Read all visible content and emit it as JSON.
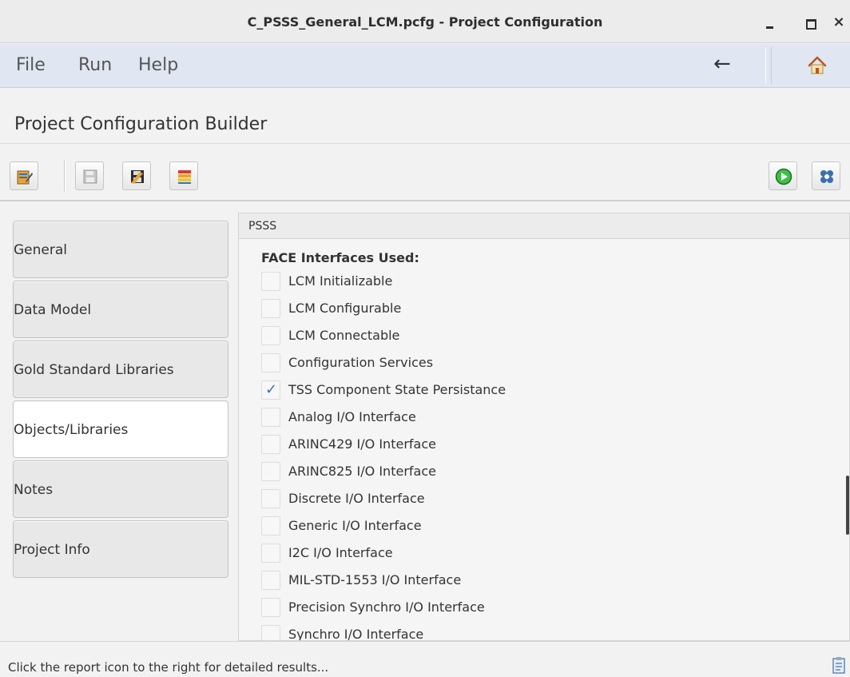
{
  "window": {
    "title": "C_PSSS_General_LCM.pcfg - Project Configuration",
    "controls": {
      "minimize": "minimize-icon",
      "maximize": "maximize-icon",
      "close": "×"
    }
  },
  "menubar": {
    "items": [
      {
        "label": "File"
      },
      {
        "label": "Run"
      },
      {
        "label": "Help"
      }
    ],
    "back_icon": "←",
    "home_icon": "home-icon"
  },
  "header": {
    "title": "Project Configuration Builder"
  },
  "toolbar": {
    "buttons": [
      {
        "name": "edit-config-icon"
      },
      {
        "name": "save-icon"
      },
      {
        "name": "save-as-icon"
      },
      {
        "name": "library-icon"
      },
      {
        "name": "run-icon"
      },
      {
        "name": "settings-icon"
      }
    ]
  },
  "sidebar": {
    "items": [
      {
        "label": "General",
        "active": false
      },
      {
        "label": "Data Model",
        "active": false
      },
      {
        "label": "Gold Standard Libraries",
        "active": false
      },
      {
        "label": "Objects/Libraries",
        "active": true
      },
      {
        "label": "Notes",
        "active": false
      },
      {
        "label": "Project Info",
        "active": false
      }
    ]
  },
  "panel": {
    "heading": "PSSS",
    "section_title": "FACE Interfaces Used:",
    "interfaces": [
      {
        "label": "LCM Initializable",
        "checked": false
      },
      {
        "label": "LCM Configurable",
        "checked": false
      },
      {
        "label": "LCM Connectable",
        "checked": false
      },
      {
        "label": "Configuration Services",
        "checked": false
      },
      {
        "label": "TSS Component State Persistance",
        "checked": true
      },
      {
        "label": "Analog I/O Interface",
        "checked": false
      },
      {
        "label": "ARINC429 I/O Interface",
        "checked": false
      },
      {
        "label": "ARINC825 I/O Interface",
        "checked": false
      },
      {
        "label": "Discrete I/O Interface",
        "checked": false
      },
      {
        "label": "Generic I/O Interface",
        "checked": false
      },
      {
        "label": "I2C I/O Interface",
        "checked": false
      },
      {
        "label": "MIL-STD-1553 I/O Interface",
        "checked": false
      },
      {
        "label": "Precision Synchro I/O Interface",
        "checked": false
      },
      {
        "label": "Synchro I/O Interface",
        "checked": false
      }
    ]
  },
  "statusbar": {
    "text": "Click the report icon to the right for detailed results...",
    "report_icon": "report-icon"
  },
  "colors": {
    "menubar_bg": "#e0e6f2",
    "check_blue": "#3a6fb0",
    "run_green": "#2eaa3c"
  }
}
